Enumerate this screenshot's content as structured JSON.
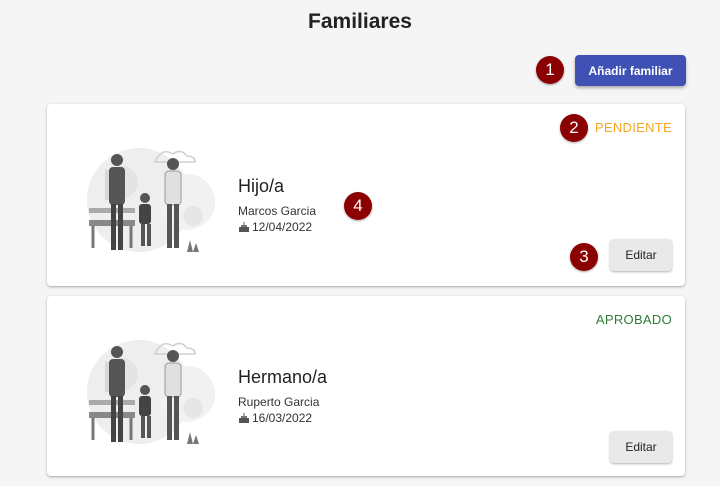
{
  "page": {
    "title": "Familiares"
  },
  "toolbar": {
    "add_label": "Añadir familiar"
  },
  "markers": [
    "1",
    "2",
    "3",
    "4"
  ],
  "colors": {
    "primary": "#3f51b5",
    "pending": "#f5a623",
    "approved": "#2e7d32",
    "marker": "#8b0000"
  },
  "cards": [
    {
      "relation": "Hijo/a",
      "name": "Marcos Garcia",
      "birthdate": "12/04/2022",
      "status": "PENDIENTE",
      "status_color": "#f5a623",
      "edit_label": "Editar",
      "icon": "cake-icon"
    },
    {
      "relation": "Hermano/a",
      "name": "Ruperto Garcia",
      "birthdate": "16/03/2022",
      "status": "APROBADO",
      "status_color": "#2e7d32",
      "edit_label": "Editar",
      "icon": "cake-icon"
    }
  ]
}
